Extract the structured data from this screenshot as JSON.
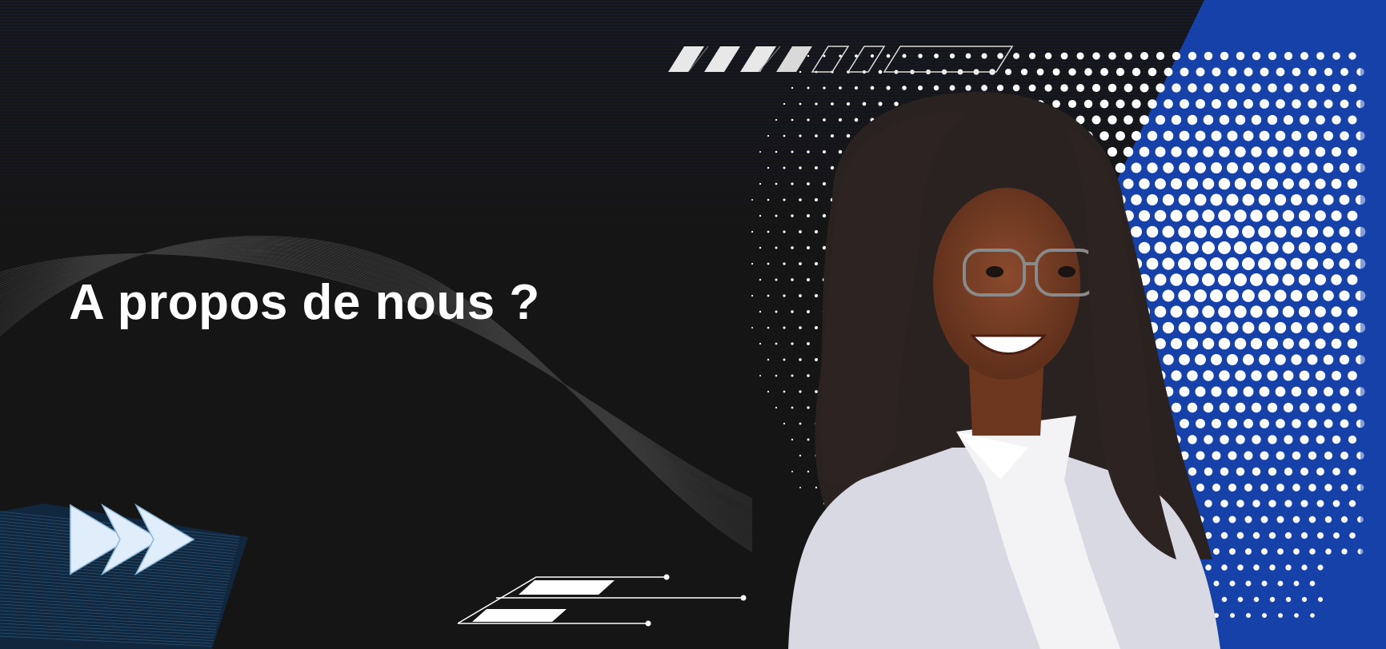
{
  "banner": {
    "headline": "A propos de nous ?"
  },
  "colors": {
    "background": "#151515",
    "accent_blue": "#1641a8",
    "text": "#ffffff",
    "stripe_blue": "#1d2a66"
  },
  "icons": {
    "arrows": "triple-chevron-right-icon",
    "deco_bars": "slanted-bars-decoration",
    "circuit": "circuit-lines-decoration",
    "halftone": "halftone-dot-pattern"
  },
  "photo": {
    "subject": "portrait-photo"
  }
}
